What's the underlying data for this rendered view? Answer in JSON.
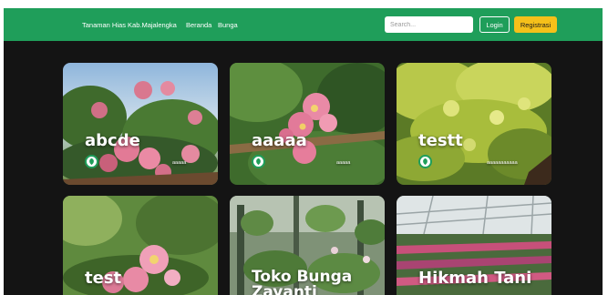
{
  "navbar": {
    "brand": "Tanaman Hias Kab.Majalengka",
    "links": [
      "Beranda",
      "Bunga"
    ],
    "search_placeholder": "Search...",
    "login_label": "Login",
    "register_label": "Registrasi"
  },
  "cards": [
    {
      "title": "abcde",
      "meta": "aaaaa"
    },
    {
      "title": "aaaaa",
      "meta": "aaaaa"
    },
    {
      "title": "testt",
      "meta": "aaaaaaaaaaa"
    },
    {
      "title": "test",
      "meta": ""
    },
    {
      "title": "Toko Bunga Zayanti",
      "meta": ""
    },
    {
      "title": "Hikmah Tani",
      "meta": ""
    }
  ],
  "colors": {
    "navbar": "#1f9e5a",
    "register": "#f5c01a",
    "background": "#141414"
  }
}
